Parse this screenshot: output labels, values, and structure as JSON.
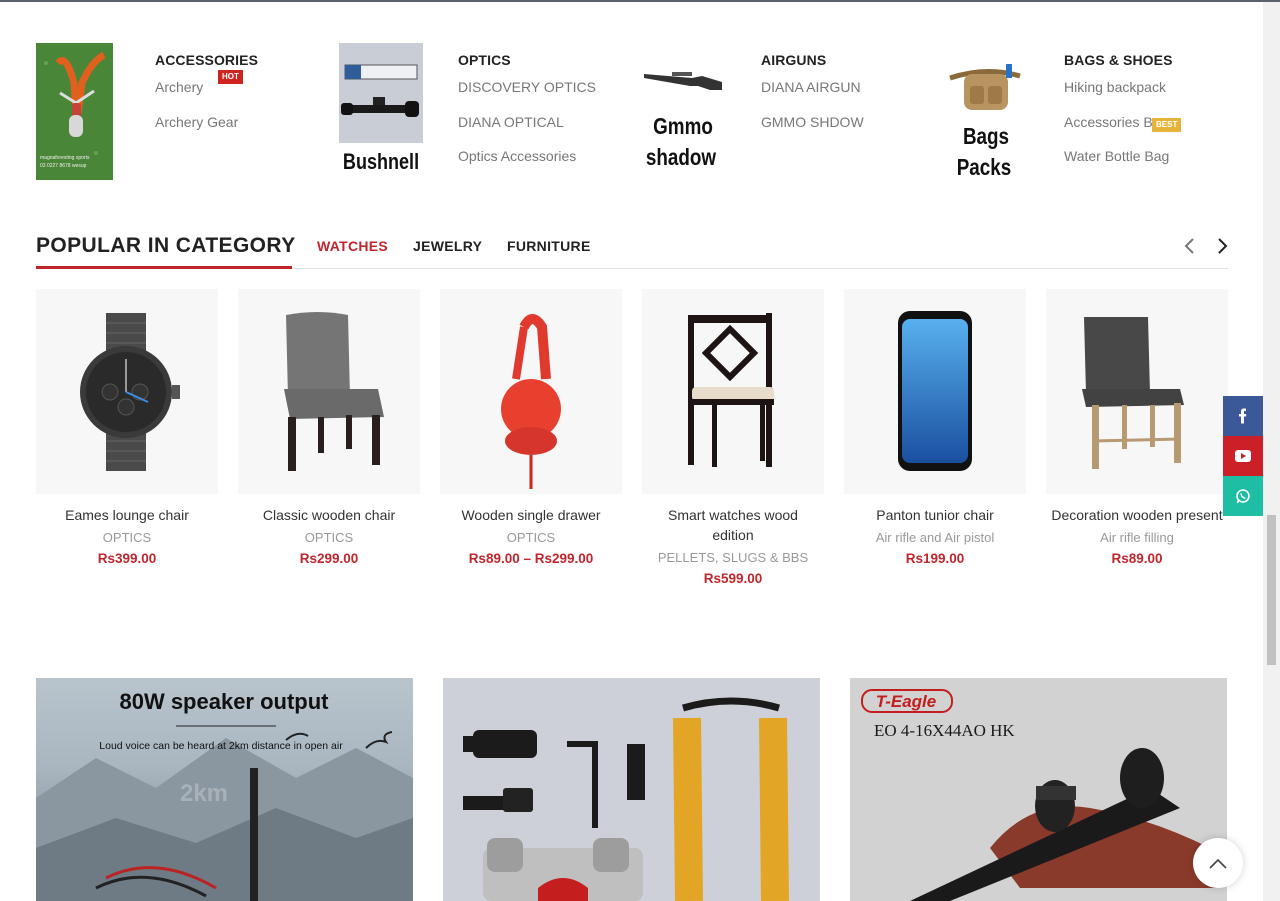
{
  "categories": [
    {
      "title": "ACCESSORIES",
      "image_label": "",
      "image_caption": "",
      "links": [
        {
          "label": "Archery",
          "badge": "HOT"
        },
        {
          "label": "Archery Gear",
          "badge": ""
        }
      ]
    },
    {
      "title": "OPTICS",
      "image_label": "Bushnell",
      "links": [
        {
          "label": "DISCOVERY OPTICS",
          "badge": ""
        },
        {
          "label": "DIANA OPTICAL",
          "badge": ""
        },
        {
          "label": "Optics Accessories",
          "badge": ""
        }
      ]
    },
    {
      "title": "AIRGUNS",
      "image_label_1": "Gmmo",
      "image_label_2": "shadow",
      "links": [
        {
          "label": "DIANA AIRGUN",
          "badge": ""
        },
        {
          "label": "GMMO SHDOW",
          "badge": ""
        }
      ]
    },
    {
      "title": "BAGS & SHOES",
      "image_label_1": "Bags",
      "image_label_2": "Packs",
      "links": [
        {
          "label": "Hiking backpack",
          "badge": ""
        },
        {
          "label": "Accessories Bag",
          "badge": "BEST"
        },
        {
          "label": "Water Bottle Bag",
          "badge": ""
        }
      ]
    }
  ],
  "popular": {
    "title": "POPULAR IN CATEGORY",
    "tabs": [
      "WATCHES",
      "JEWELRY",
      "FURNITURE"
    ],
    "active_tab": "WATCHES",
    "products": [
      {
        "name": "Eames lounge chair",
        "category": "OPTICS",
        "price": "Rs399.00",
        "image": "watch"
      },
      {
        "name": "Classic wooden chair",
        "category": "OPTICS",
        "price": "Rs299.00",
        "image": "gray-chair"
      },
      {
        "name": "Wooden single drawer",
        "category": "OPTICS",
        "price": "Rs89.00 – Rs299.00",
        "image": "red-headphones"
      },
      {
        "name": "Smart watches wood edition",
        "category": "PELLETS, SLUGS & BBS",
        "price": "Rs599.00",
        "image": "dark-wood-chair"
      },
      {
        "name": "Panton tunior chair",
        "category": "Air rifle and Air pistol",
        "price": "Rs199.00",
        "image": "phone"
      },
      {
        "name": "Decoration wooden present",
        "category": "Air rifle filling",
        "price": "Rs89.00",
        "image": "dining-chair"
      }
    ]
  },
  "banners": [
    {
      "headline": "80W speaker output",
      "sub": "Loud voice can be heard at 2km distance in open air",
      "distance": "2km"
    },
    {
      "headline": "",
      "sub": ""
    },
    {
      "brand": "T-Eagle",
      "model": "EO 4-16X44AO HK"
    }
  ],
  "social": [
    "facebook-icon",
    "youtube-icon",
    "whatsapp-icon"
  ],
  "colors": {
    "accent": "#c2252c",
    "facebook": "#3b5998",
    "youtube": "#cb2027",
    "whatsapp": "#1ebea5"
  }
}
